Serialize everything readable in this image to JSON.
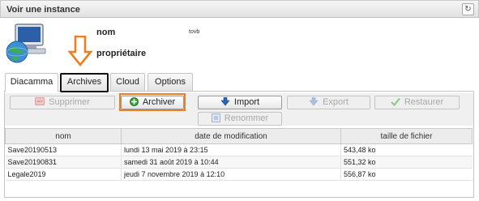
{
  "window": {
    "title": "Voir une instance"
  },
  "fields": {
    "nom_label": "nom",
    "nom_value": "tovb",
    "proprietaire_label": "propriétaire"
  },
  "tabs": [
    {
      "label": "Diacamma",
      "active": true
    },
    {
      "label": "Archives",
      "active": false,
      "highlighted": true
    },
    {
      "label": "Cloud",
      "active": false
    },
    {
      "label": "Options",
      "active": false
    }
  ],
  "toolbar": {
    "supprimer": "Supprimer",
    "archiver": "Archiver",
    "import": "Import",
    "export": "Export",
    "restaurer": "Restaurer",
    "renommer": "Renommer"
  },
  "table": {
    "columns": [
      "nom",
      "date de modification",
      "taille de fichier"
    ],
    "rows": [
      [
        "Save20190513",
        "lundi 13 mai 2019 à 23:15",
        "543,48 ko"
      ],
      [
        "Save20190831",
        "samedi 31 août 2019 à 10:44",
        "551,32 ko"
      ],
      [
        "Legale2019",
        "jeudi 7 novembre 2019 à 12:10",
        "556,87 ko"
      ]
    ]
  },
  "colors": {
    "annotation": "#f07d1f",
    "add_green": "#2e9e2e",
    "delete_red": "#d33"
  }
}
